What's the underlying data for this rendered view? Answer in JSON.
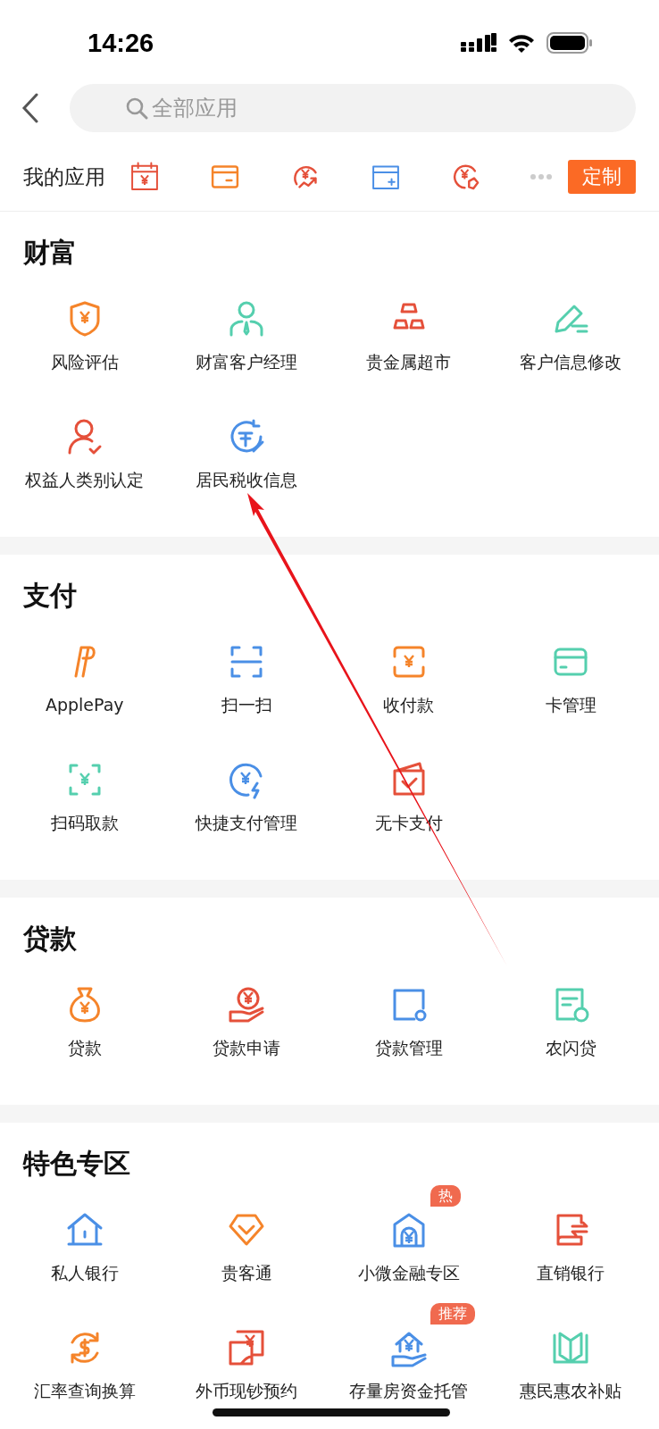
{
  "status_bar": {
    "time": "14:26"
  },
  "search": {
    "placeholder": "全部应用"
  },
  "my_apps": {
    "label": "我的应用",
    "button": "定制"
  },
  "sections": [
    {
      "title": "财富",
      "items": [
        {
          "label": "风险评估"
        },
        {
          "label": "财富客户经理"
        },
        {
          "label": "贵金属超市"
        },
        {
          "label": "客户信息修改"
        },
        {
          "label": "权益人类别认定"
        },
        {
          "label": "居民税收信息"
        }
      ]
    },
    {
      "title": "支付",
      "items": [
        {
          "label": "ApplePay"
        },
        {
          "label": "扫一扫"
        },
        {
          "label": "收付款"
        },
        {
          "label": "卡管理"
        },
        {
          "label": "扫码取款"
        },
        {
          "label": "快捷支付管理"
        },
        {
          "label": "无卡支付"
        }
      ]
    },
    {
      "title": "贷款",
      "items": [
        {
          "label": "贷款"
        },
        {
          "label": "贷款申请"
        },
        {
          "label": "贷款管理"
        },
        {
          "label": "农闪贷"
        }
      ]
    },
    {
      "title": "特色专区",
      "items": [
        {
          "label": "私人银行"
        },
        {
          "label": "贵客通"
        },
        {
          "label": "小微金融专区",
          "badge": "热"
        },
        {
          "label": "直销银行"
        },
        {
          "label": "汇率查询换算"
        },
        {
          "label": "外币现钞预约"
        },
        {
          "label": "存量房资金托管",
          "badge": "推荐"
        },
        {
          "label": "惠民惠农补贴"
        }
      ]
    }
  ]
}
